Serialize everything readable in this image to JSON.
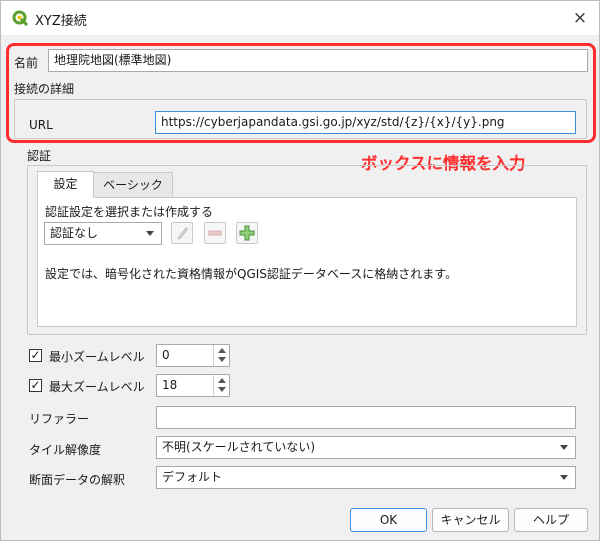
{
  "window": {
    "title": "XYZ接続",
    "close_label": "×"
  },
  "name": {
    "label": "名前",
    "value": "地理院地図(標準地図)"
  },
  "connection": {
    "section_label": "接続の詳細",
    "url_label": "URL",
    "url_value": "https://cyberjapandata.gsi.go.jp/xyz/std/{z}/{x}/{y}.png"
  },
  "annotation": {
    "text": "ボックスに情報を入力",
    "color": "#ff2d2d"
  },
  "auth": {
    "section_label": "認証",
    "tabs": [
      "設定",
      "ベーシック"
    ],
    "select_label": "認証設定を選択または作成する",
    "combo_value": "認証なし",
    "info_text": "設定では、暗号化された資格情報がQGIS認証データベースに格納されます。"
  },
  "zoom": {
    "min_label": "最小ズームレベル",
    "min_value": "0",
    "min_checked": "✓",
    "max_label": "最大ズームレベル",
    "max_value": "18",
    "max_checked": "✓"
  },
  "referer": {
    "label": "リファラー",
    "value": ""
  },
  "tile_resolution": {
    "label": "タイル解像度",
    "value": "不明(スケールされていない)"
  },
  "elevation": {
    "label": "断面データの解釈",
    "value": "デフォルト"
  },
  "buttons": {
    "ok": "OK",
    "cancel": "キャンセル",
    "help": "ヘルプ"
  }
}
